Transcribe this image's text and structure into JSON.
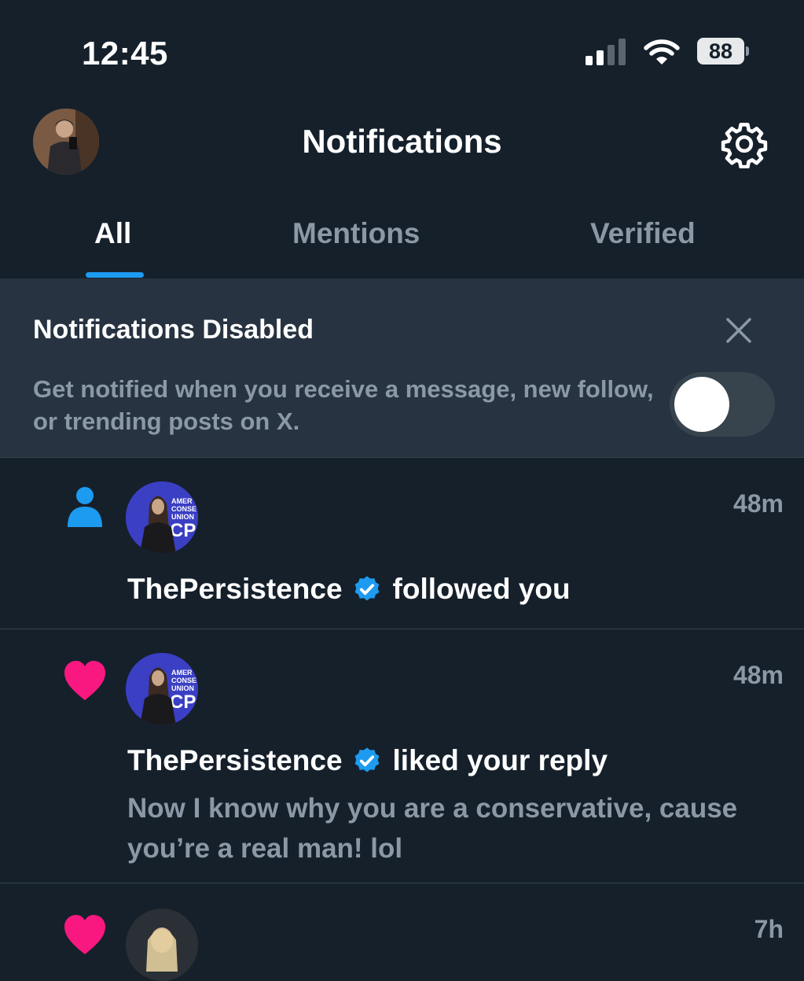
{
  "status_bar": {
    "time": "12:45",
    "battery": "88"
  },
  "header": {
    "title": "Notifications"
  },
  "tabs": [
    {
      "label": "All",
      "active": true
    },
    {
      "label": "Mentions",
      "active": false
    },
    {
      "label": "Verified",
      "active": false
    }
  ],
  "banner": {
    "title": "Notifications Disabled",
    "text": "Get notified when you receive a message, new follow, or trending posts on X.",
    "toggle_on": false
  },
  "notifications": [
    {
      "icon": "person-icon",
      "user": "ThePersistence",
      "verified": true,
      "action": "followed you",
      "time": "48m",
      "quote": ""
    },
    {
      "icon": "heart-icon",
      "user": "ThePersistence",
      "verified": true,
      "action": "liked your reply",
      "time": "48m",
      "quote": "Now I know why you are a conservative, cause you’re a real man! lol"
    },
    {
      "icon": "heart-icon",
      "user": "",
      "verified": false,
      "action": "",
      "time": "7h",
      "quote": ""
    }
  ],
  "colors": {
    "background": "#15202b",
    "banner": "#273340",
    "accent": "#1d9bf0",
    "heart": "#f91880",
    "muted": "#8b98a5"
  }
}
